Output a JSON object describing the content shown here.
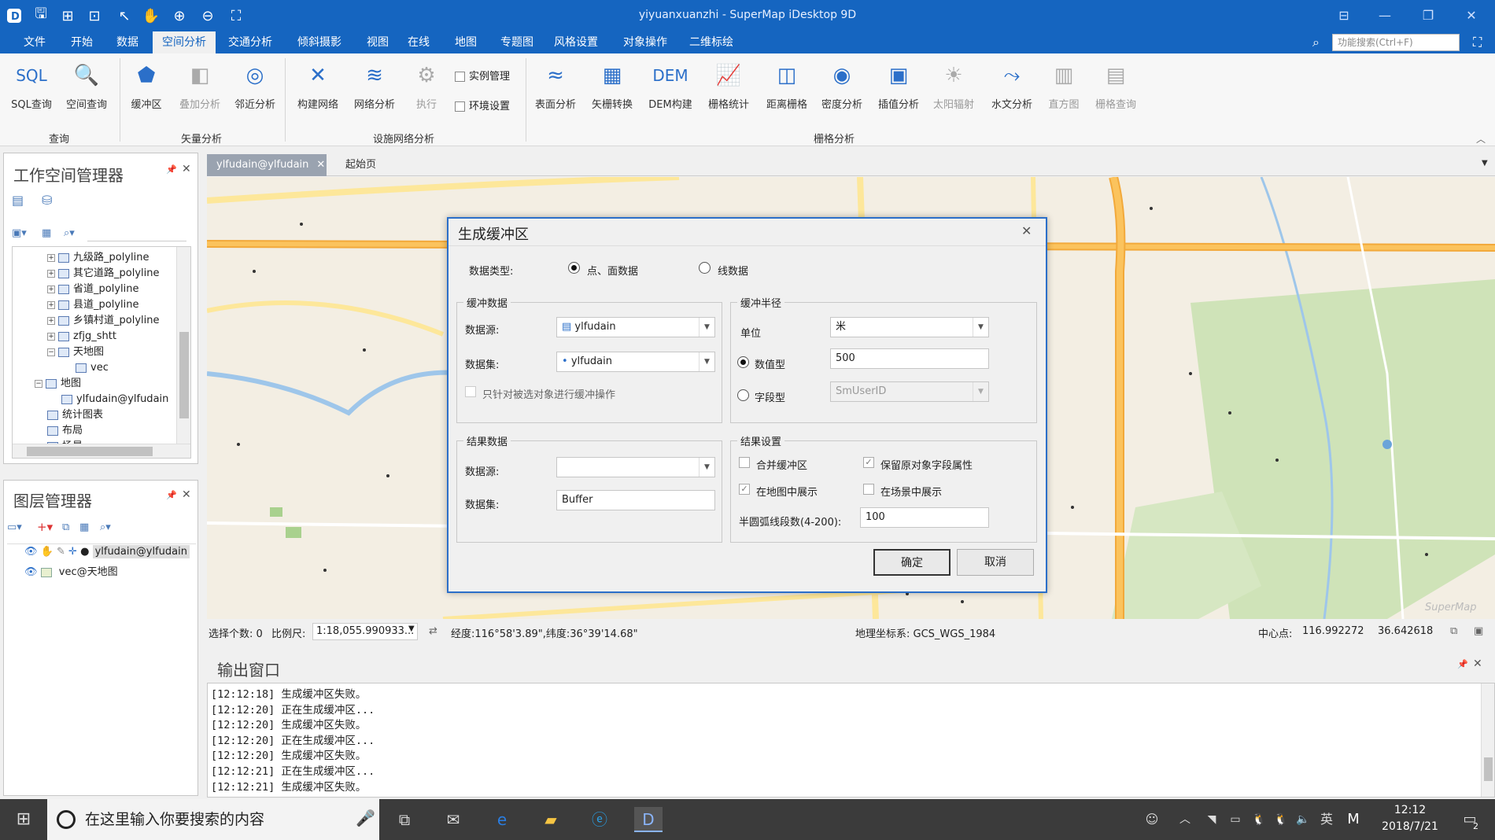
{
  "window": {
    "title": "yiyuanxuanzhi - SuperMap iDesktop 9D"
  },
  "menu": [
    "文件",
    "开始",
    "数据",
    "空间分析",
    "交通分析",
    "倾斜摄影",
    "视图",
    "在线",
    "地图",
    "专题图",
    "风格设置",
    "对象操作",
    "二维标绘"
  ],
  "menu_active": 3,
  "search_placeholder": "功能搜索(Ctrl+F)",
  "ribbon": {
    "buttons": [
      "SQL查询",
      "空间查询",
      "缓冲区",
      "叠加分析",
      "邻近分析",
      "构建网络",
      "网络分析",
      "执行",
      "表面分析",
      "矢栅转换",
      "DEM构建",
      "栅格统计",
      "距离栅格",
      "密度分析",
      "插值分析",
      "太阳辐射",
      "水文分析",
      "直方图",
      "栅格查询"
    ],
    "checks": [
      "实例管理",
      "环境设置"
    ],
    "groups": [
      "查询",
      "矢量分析",
      "设施网络分析",
      "栅格分析"
    ]
  },
  "workspace": {
    "title": "工作空间管理器",
    "items": [
      "九级路_polyline",
      "其它道路_polyline",
      "省道_polyline",
      "县道_polyline",
      "乡镇村道_polyline",
      "zfjg_shtt",
      "天地图",
      "vec",
      "地图",
      "ylfudain@ylfudain",
      "统计图表",
      "布局",
      "场景"
    ]
  },
  "layers": {
    "title": "图层管理器",
    "items": [
      "ylfudain@ylfudain",
      "vec@天地图"
    ]
  },
  "tabs": [
    "ylfudain@ylfudain",
    "起始页"
  ],
  "dialog": {
    "title": "生成缓冲区",
    "data_type_label": "数据类型:",
    "radio_point": "点、面数据",
    "radio_line": "线数据",
    "buffer_data": "缓冲数据",
    "source_label": "数据源:",
    "source_value": "ylfudain",
    "dataset_label": "数据集:",
    "dataset_value": "ylfudain",
    "only_selected": "只针对被选对象进行缓冲操作",
    "radius": "缓冲半径",
    "unit_label": "单位",
    "unit_value": "米",
    "numeric_label": "数值型",
    "numeric_value": "500",
    "field_label": "字段型",
    "field_value": "SmUserID",
    "result_data": "结果数据",
    "result_source_label": "数据源:",
    "result_dataset_label": "数据集:",
    "result_dataset_value": "Buffer",
    "result_settings": "结果设置",
    "merge": "合并缓冲区",
    "keep_fields": "保留原对象字段属性",
    "show_map": "在地图中展示",
    "show_scene": "在场景中展示",
    "segments_label": "半圆弧线段数(4-200):",
    "segments_value": "100",
    "ok": "确定",
    "cancel": "取消"
  },
  "status": {
    "selected": "选择个数: 0",
    "scale_label": "比例尺:",
    "scale_value": "1:18,055.990933...",
    "coords": "经度:116°58'3.89\",纬度:36°39'14.68\"",
    "crs": "地理坐标系: GCS_WGS_1984",
    "center_label": "中心点:",
    "center_x": "116.992272",
    "center_y": "36.642618"
  },
  "output": {
    "title": "输出窗口",
    "lines": [
      "[12:12:18] 生成缓冲区失败。",
      "[12:12:20] 正在生成缓冲区...",
      "[12:12:20] 生成缓冲区失败。",
      "[12:12:20] 正在生成缓冲区...",
      "[12:12:20] 生成缓冲区失败。",
      "[12:12:21] 正在生成缓冲区...",
      "[12:12:21] 生成缓冲区失败。"
    ]
  },
  "taskbar": {
    "search": "在这里输入你要搜索的内容",
    "ime": "英",
    "time": "12:12",
    "date": "2018/7/21",
    "notif": "2"
  },
  "map_watermark": "SuperMap"
}
